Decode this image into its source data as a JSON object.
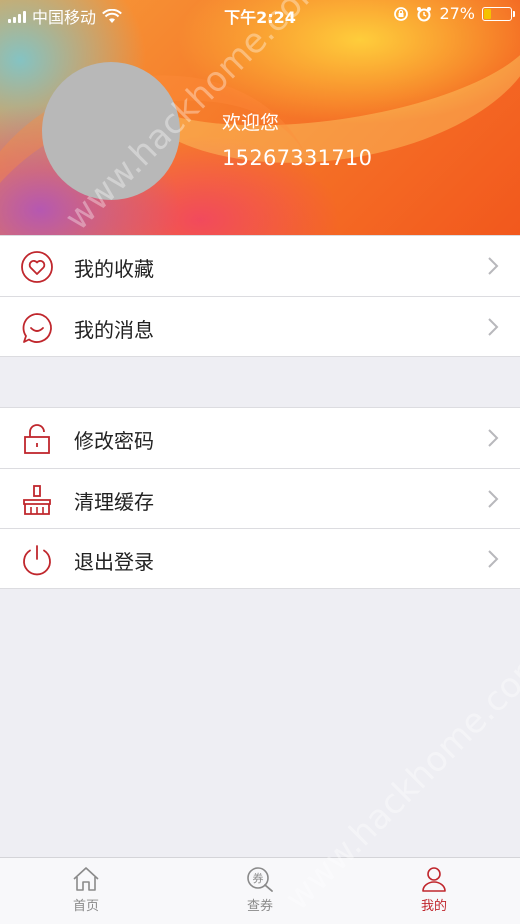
{
  "status_bar": {
    "carrier": "中国移动",
    "time": "下午2:24",
    "battery": "27%",
    "battery_level": 0.27,
    "icons": [
      "signal-icon",
      "wifi-icon",
      "rotation-lock-icon",
      "alarm-icon",
      "battery-icon"
    ]
  },
  "profile": {
    "welcome": "欢迎您",
    "phone": "15267331710"
  },
  "menu_groups": [
    {
      "items": [
        {
          "label": "我的收藏",
          "icon": "heart-icon"
        },
        {
          "label": "我的消息",
          "icon": "message-icon"
        }
      ]
    },
    {
      "items": [
        {
          "label": "修改密码",
          "icon": "lock-icon"
        },
        {
          "label": "清理缓存",
          "icon": "broom-icon"
        },
        {
          "label": "退出登录",
          "icon": "power-icon"
        }
      ]
    }
  ],
  "tabbar": {
    "tabs": [
      {
        "label": "首页",
        "icon": "home-icon",
        "active": false
      },
      {
        "label": "查券",
        "icon": "coupon-search-icon",
        "active": false
      },
      {
        "label": "我的",
        "icon": "user-icon",
        "active": true
      }
    ]
  },
  "watermark": "www.hackhome.com",
  "colors": {
    "accent": "#c0272d",
    "icon_red": "#c0272d",
    "background": "#eeeef3"
  }
}
